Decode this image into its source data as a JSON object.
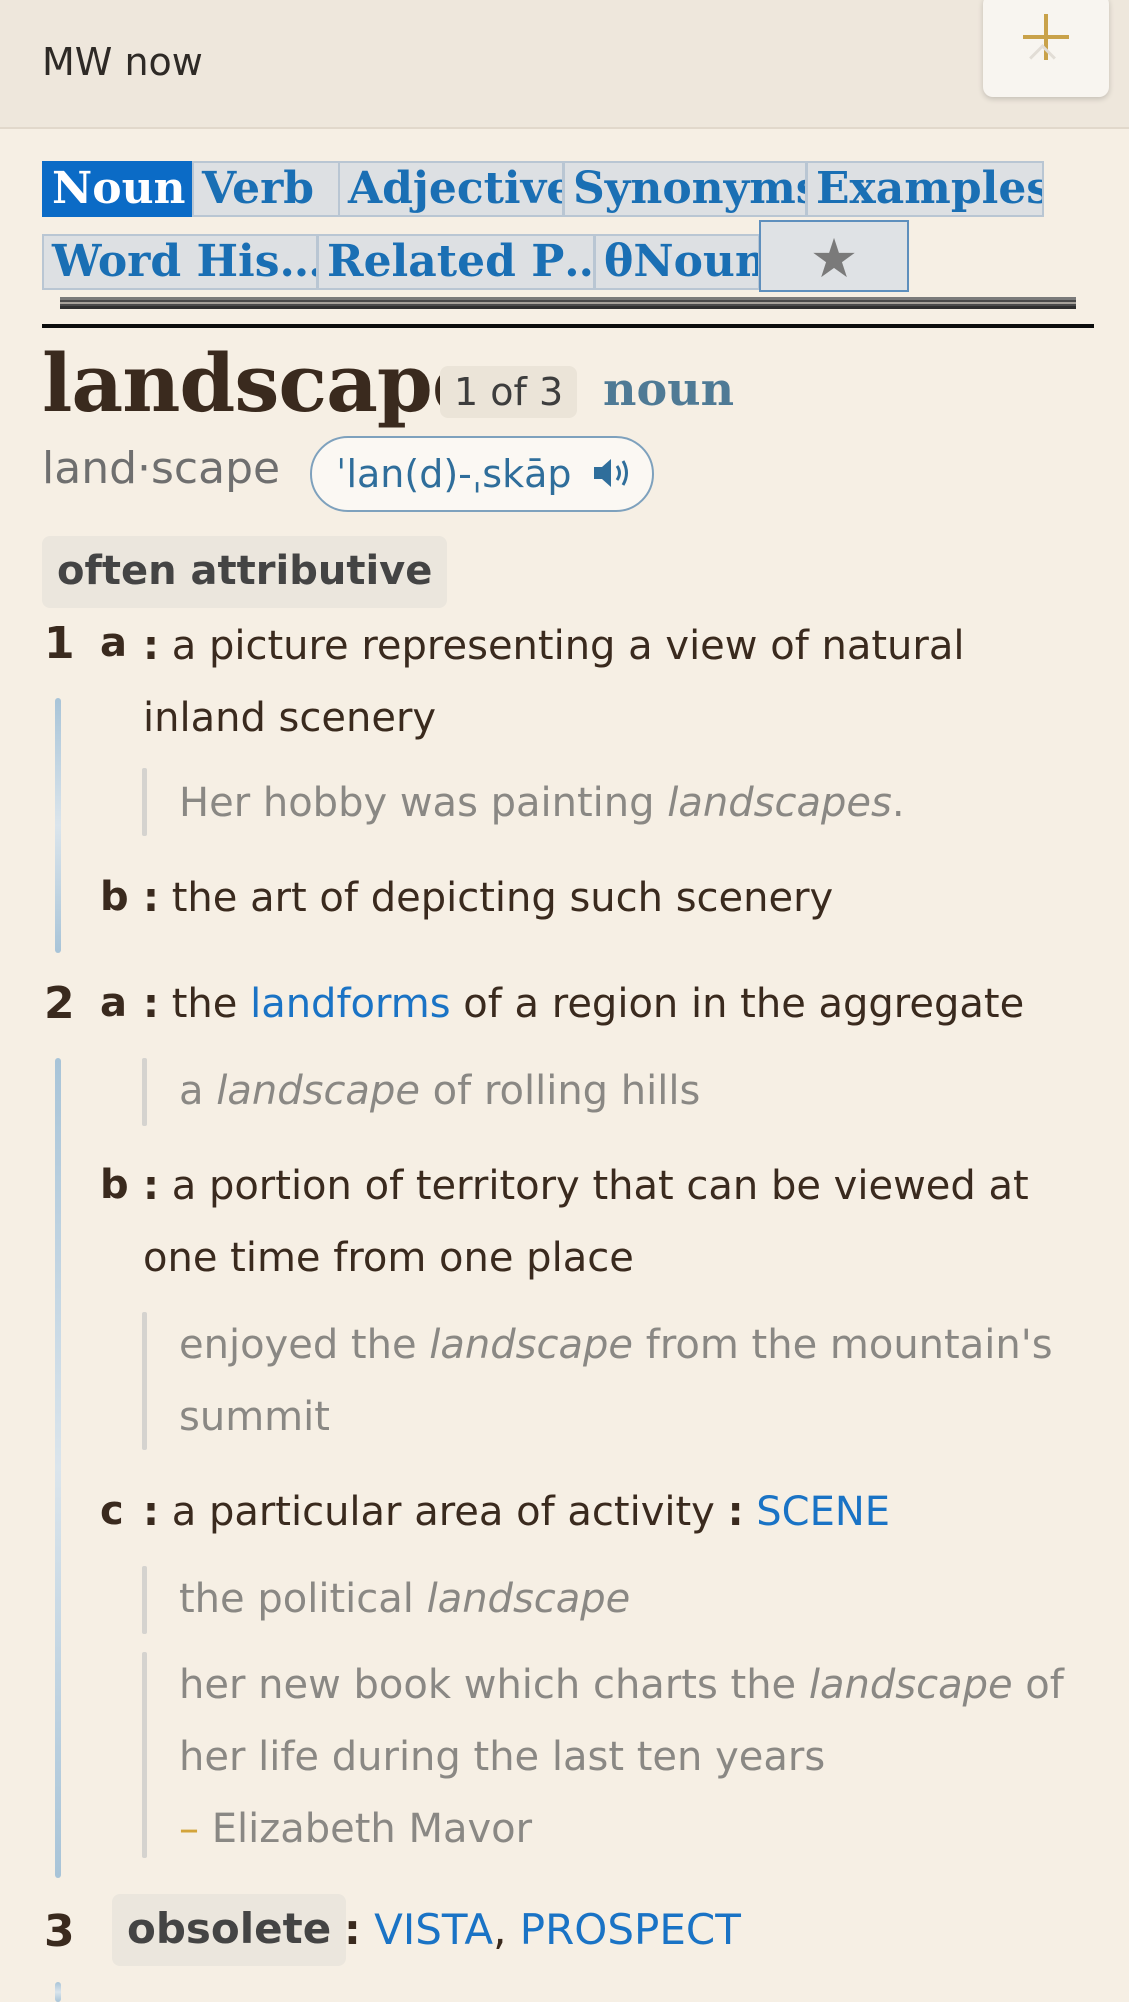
{
  "topbar": {
    "title": "MW now"
  },
  "tabs": [
    {
      "label": "Noun",
      "active": true
    },
    {
      "label": "Verb"
    },
    {
      "label": "Adjective"
    },
    {
      "label": "Synonyms"
    },
    {
      "label": "Examples"
    },
    {
      "label": "Word His…"
    },
    {
      "label": "Related P…"
    },
    {
      "label": "θNoun"
    },
    {
      "label": "★"
    }
  ],
  "entry": {
    "headword": "landscape",
    "count": "1 of 3",
    "pos": "noun",
    "syllables": "land·scape",
    "pronunciation": "ˈlan(d)-ˌskāp",
    "label": "often attributive"
  },
  "senses": {
    "s1": {
      "num": "1",
      "a": {
        "letter": "a",
        "colon": ":",
        "text_line1": "a picture representing a view of natural",
        "text_line2": "inland scenery",
        "example": {
          "before": "Her hobby was painting ",
          "italic": "landscapes",
          "after": "."
        }
      },
      "b": {
        "letter": "b",
        "colon": ":",
        "text": "the art of depicting such scenery"
      }
    },
    "s2": {
      "num": "2",
      "a": {
        "letter": "a",
        "colon": ":",
        "before": "the ",
        "link": "landforms",
        "after": " of a region in the aggregate",
        "example": {
          "before": "a ",
          "italic": "landscape",
          "after": " of rolling hills"
        }
      },
      "b": {
        "letter": "b",
        "colon": ":",
        "text_line1": "a portion of territory that can be viewed at",
        "text_line2": "one time from one place",
        "example": {
          "before": "enjoyed the ",
          "italic": "landscape",
          "after": " from the mountain's",
          "line2": "summit"
        }
      },
      "c": {
        "letter": "c",
        "colon": ":",
        "text": "a particular area of activity",
        "colon2": ":",
        "link": "SCENE",
        "example1": {
          "before": "the political ",
          "italic": "landscape"
        },
        "example2": {
          "before": "her new book which charts the ",
          "italic": "landscape",
          "after": " of",
          "line2": "her life during the last ten years",
          "dash": "–",
          "author": "Elizabeth Mavor"
        }
      }
    },
    "s3": {
      "num": "3",
      "label": "obsolete",
      "colon": ":",
      "link1": "VISTA",
      "comma": ",",
      "link2": "PROSPECT"
    }
  },
  "colors": {
    "accent": "#0b6bc6",
    "link": "#1a73c5",
    "background": "#f6efe4",
    "gold": "#c9a24a"
  },
  "icons": [
    "plus-icon",
    "chevron-up-icon",
    "star-icon",
    "speaker-icon"
  ]
}
